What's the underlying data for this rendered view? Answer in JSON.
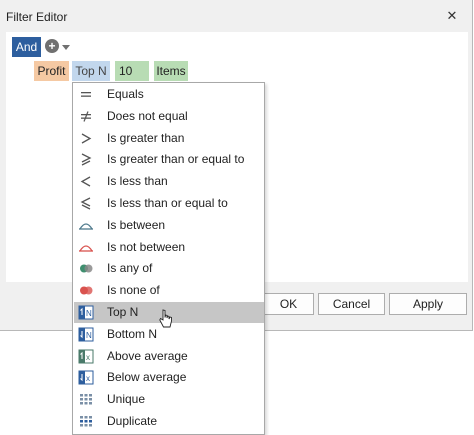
{
  "dialog": {
    "title": "Filter Editor",
    "close_glyph": "✕"
  },
  "filter": {
    "group_operator": "And",
    "add_glyph": "+",
    "condition": {
      "field": "Profit",
      "operator": "Top N",
      "value": "10",
      "unit": "Items"
    }
  },
  "buttons": {
    "ok": "OK",
    "cancel": "Cancel",
    "apply": "Apply"
  },
  "menu": {
    "items": [
      {
        "label": "Equals",
        "icon": "equals-icon"
      },
      {
        "label": "Does not equal",
        "icon": "not-equal-icon"
      },
      {
        "label": "Is greater than",
        "icon": "greater-than-icon"
      },
      {
        "label": "Is greater than or equal to",
        "icon": "greater-or-equal-icon"
      },
      {
        "label": "Is less than",
        "icon": "less-than-icon"
      },
      {
        "label": "Is less than or equal to",
        "icon": "less-or-equal-icon"
      },
      {
        "label": "Is between",
        "icon": "between-icon"
      },
      {
        "label": "Is not between",
        "icon": "not-between-icon"
      },
      {
        "label": "Is any of",
        "icon": "any-of-icon"
      },
      {
        "label": "Is none of",
        "icon": "none-of-icon"
      },
      {
        "label": "Top N",
        "icon": "top-n-icon",
        "highlighted": true
      },
      {
        "label": "Bottom N",
        "icon": "bottom-n-icon"
      },
      {
        "label": "Above average",
        "icon": "above-average-icon"
      },
      {
        "label": "Below average",
        "icon": "below-average-icon"
      },
      {
        "label": "Unique",
        "icon": "unique-icon"
      },
      {
        "label": "Duplicate",
        "icon": "duplicate-icon"
      }
    ]
  },
  "colors": {
    "and_chip": "#2d5e9e",
    "field_chip": "#f5c9a3",
    "operator_chip": "#c2d7ed",
    "value_chip": "#b8dcb4",
    "menu_highlight": "#c6c6c6",
    "between_icon": "#4e7a8c",
    "not_between_icon": "#d9534f",
    "any_of_icon": "#3f8f6f",
    "none_of_icon": "#d9534f",
    "top_bottom_icon": "#2d5e9e"
  }
}
